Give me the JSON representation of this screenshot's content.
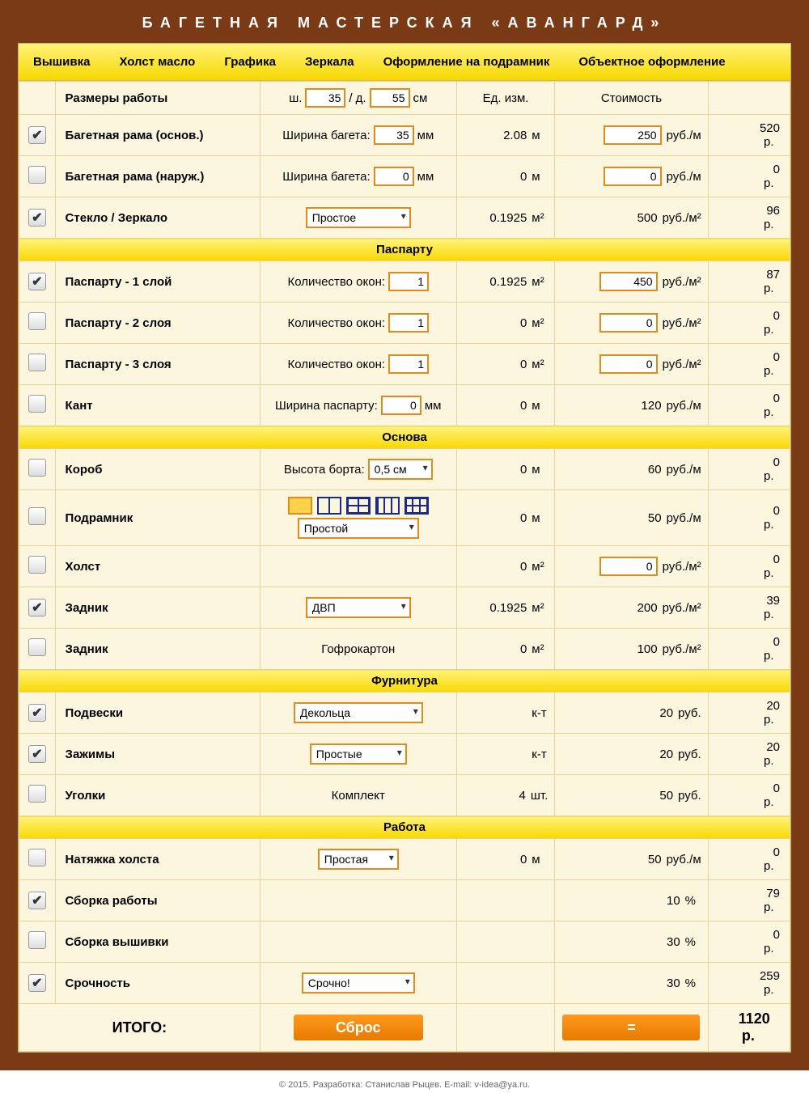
{
  "title": "БАГЕТНАЯ МАСТЕРСКАЯ «АВАНГАРД»",
  "tabs": [
    "Вышивка",
    "Холст масло",
    "Графика",
    "Зеркала",
    "Оформление на подрамник",
    "Объектное оформление"
  ],
  "hdr": {
    "dims": "Размеры работы",
    "w": "ш.",
    "l": "д.",
    "cm": "см",
    "wv": "35",
    "lv": "55",
    "unit": "Ед. изм.",
    "cost": "Стоимость"
  },
  "sects": {
    "pasp": "Паспарту",
    "osn": "Основа",
    "furn": "Фурнитура",
    "rab": "Работа"
  },
  "rows": {
    "frame1": {
      "chk": true,
      "name": "Багетная рама (основ.)",
      "lbl": "Ширина багета:",
      "val": "35",
      "mm": "мм",
      "u": "2.08",
      "uu": "м",
      "p": "250",
      "pu": "руб./м",
      "c": "520",
      "cu": "р."
    },
    "frame2": {
      "chk": false,
      "name": "Багетная рама (наруж.)",
      "lbl": "Ширина багета:",
      "val": "0",
      "mm": "мм",
      "u": "0",
      "uu": "м",
      "p": "0",
      "pu": "руб./м",
      "c": "0",
      "cu": "р."
    },
    "glass": {
      "chk": true,
      "name": "Стекло / Зеркало",
      "sel": "Простое",
      "u": "0.1925",
      "uu": "м²",
      "p": "500",
      "pu": "руб./м²",
      "c": "96",
      "cu": "р."
    },
    "pasp1": {
      "chk": true,
      "name": "Паспарту - 1 слой",
      "lbl": "Количество окон:",
      "val": "1",
      "u": "0.1925",
      "uu": "м²",
      "p": "450",
      "pu": "руб./м²",
      "c": "87",
      "cu": "р."
    },
    "pasp2": {
      "chk": false,
      "name": "Паспарту - 2 слоя",
      "lbl": "Количество окон:",
      "val": "1",
      "u": "0",
      "uu": "м²",
      "p": "0",
      "pu": "руб./м²",
      "c": "0",
      "cu": "р."
    },
    "pasp3": {
      "chk": false,
      "name": "Паспарту - 3 слоя",
      "lbl": "Количество окон:",
      "val": "1",
      "u": "0",
      "uu": "м²",
      "p": "0",
      "pu": "руб./м²",
      "c": "0",
      "cu": "р."
    },
    "kant": {
      "chk": false,
      "name": "Кант",
      "lbl": "Ширина паспарту:",
      "val": "0",
      "mm": "мм",
      "u": "0",
      "uu": "м",
      "p": "120",
      "pu": "руб./м",
      "c": "0",
      "cu": "р."
    },
    "korob": {
      "chk": false,
      "name": "Короб",
      "lbl": "Высота борта:",
      "sel": "0,5 см",
      "u": "0",
      "uu": "м",
      "p": "60",
      "pu": "руб./м",
      "c": "0",
      "cu": "р."
    },
    "podr": {
      "chk": false,
      "name": "Подрамник",
      "sel": "Простой",
      "u": "0",
      "uu": "м",
      "p": "50",
      "pu": "руб./м",
      "c": "0",
      "cu": "р."
    },
    "holst": {
      "chk": false,
      "name": "Холст",
      "u": "0",
      "uu": "м²",
      "p": "0",
      "pu": "руб./м²",
      "c": "0",
      "cu": "р."
    },
    "zad1": {
      "chk": true,
      "name": "Задник",
      "sel": "ДВП",
      "u": "0.1925",
      "uu": "м²",
      "p": "200",
      "pu": "руб./м²",
      "c": "39",
      "cu": "р."
    },
    "zad2": {
      "chk": false,
      "name": "Задник",
      "txt": "Гофрокартон",
      "u": "0",
      "uu": "м²",
      "p": "100",
      "pu": "руб./м²",
      "c": "0",
      "cu": "р."
    },
    "podv": {
      "chk": true,
      "name": "Подвески",
      "sel": "Декольца",
      "u": "",
      "uu": "к-т",
      "p": "20",
      "pu": "руб.",
      "c": "20",
      "cu": "р."
    },
    "zaj": {
      "chk": true,
      "name": "Зажимы",
      "sel": "Простые",
      "u": "",
      "uu": "к-т",
      "p": "20",
      "pu": "руб.",
      "c": "20",
      "cu": "р."
    },
    "ugol": {
      "chk": false,
      "name": "Уголки",
      "txt": "Комплект",
      "u": "4",
      "uu": "шт.",
      "p": "50",
      "pu": "руб.",
      "c": "0",
      "cu": "р."
    },
    "nat": {
      "chk": false,
      "name": "Натяжка холста",
      "sel": "Простая",
      "u": "0",
      "uu": "м",
      "p": "50",
      "pu": "руб./м",
      "c": "0",
      "cu": "р."
    },
    "sbr": {
      "chk": true,
      "name": "Сборка работы",
      "p": "10",
      "pu": "%",
      "c": "79",
      "cu": "р."
    },
    "sbv": {
      "chk": false,
      "name": "Сборка вышивки",
      "p": "30",
      "pu": "%",
      "c": "0",
      "cu": "р."
    },
    "sro": {
      "chk": true,
      "name": "Срочность",
      "sel": "Срочно!",
      "p": "30",
      "pu": "%",
      "c": "259",
      "cu": "р."
    }
  },
  "total": {
    "lbl": "ИТОГО:",
    "reset": "Сброс",
    "eq": "=",
    "sum": "1120",
    "cu": "р."
  },
  "footer": "© 2015. Разработка: Станислав Рыцев. E-mail: v-idea@ya.ru."
}
